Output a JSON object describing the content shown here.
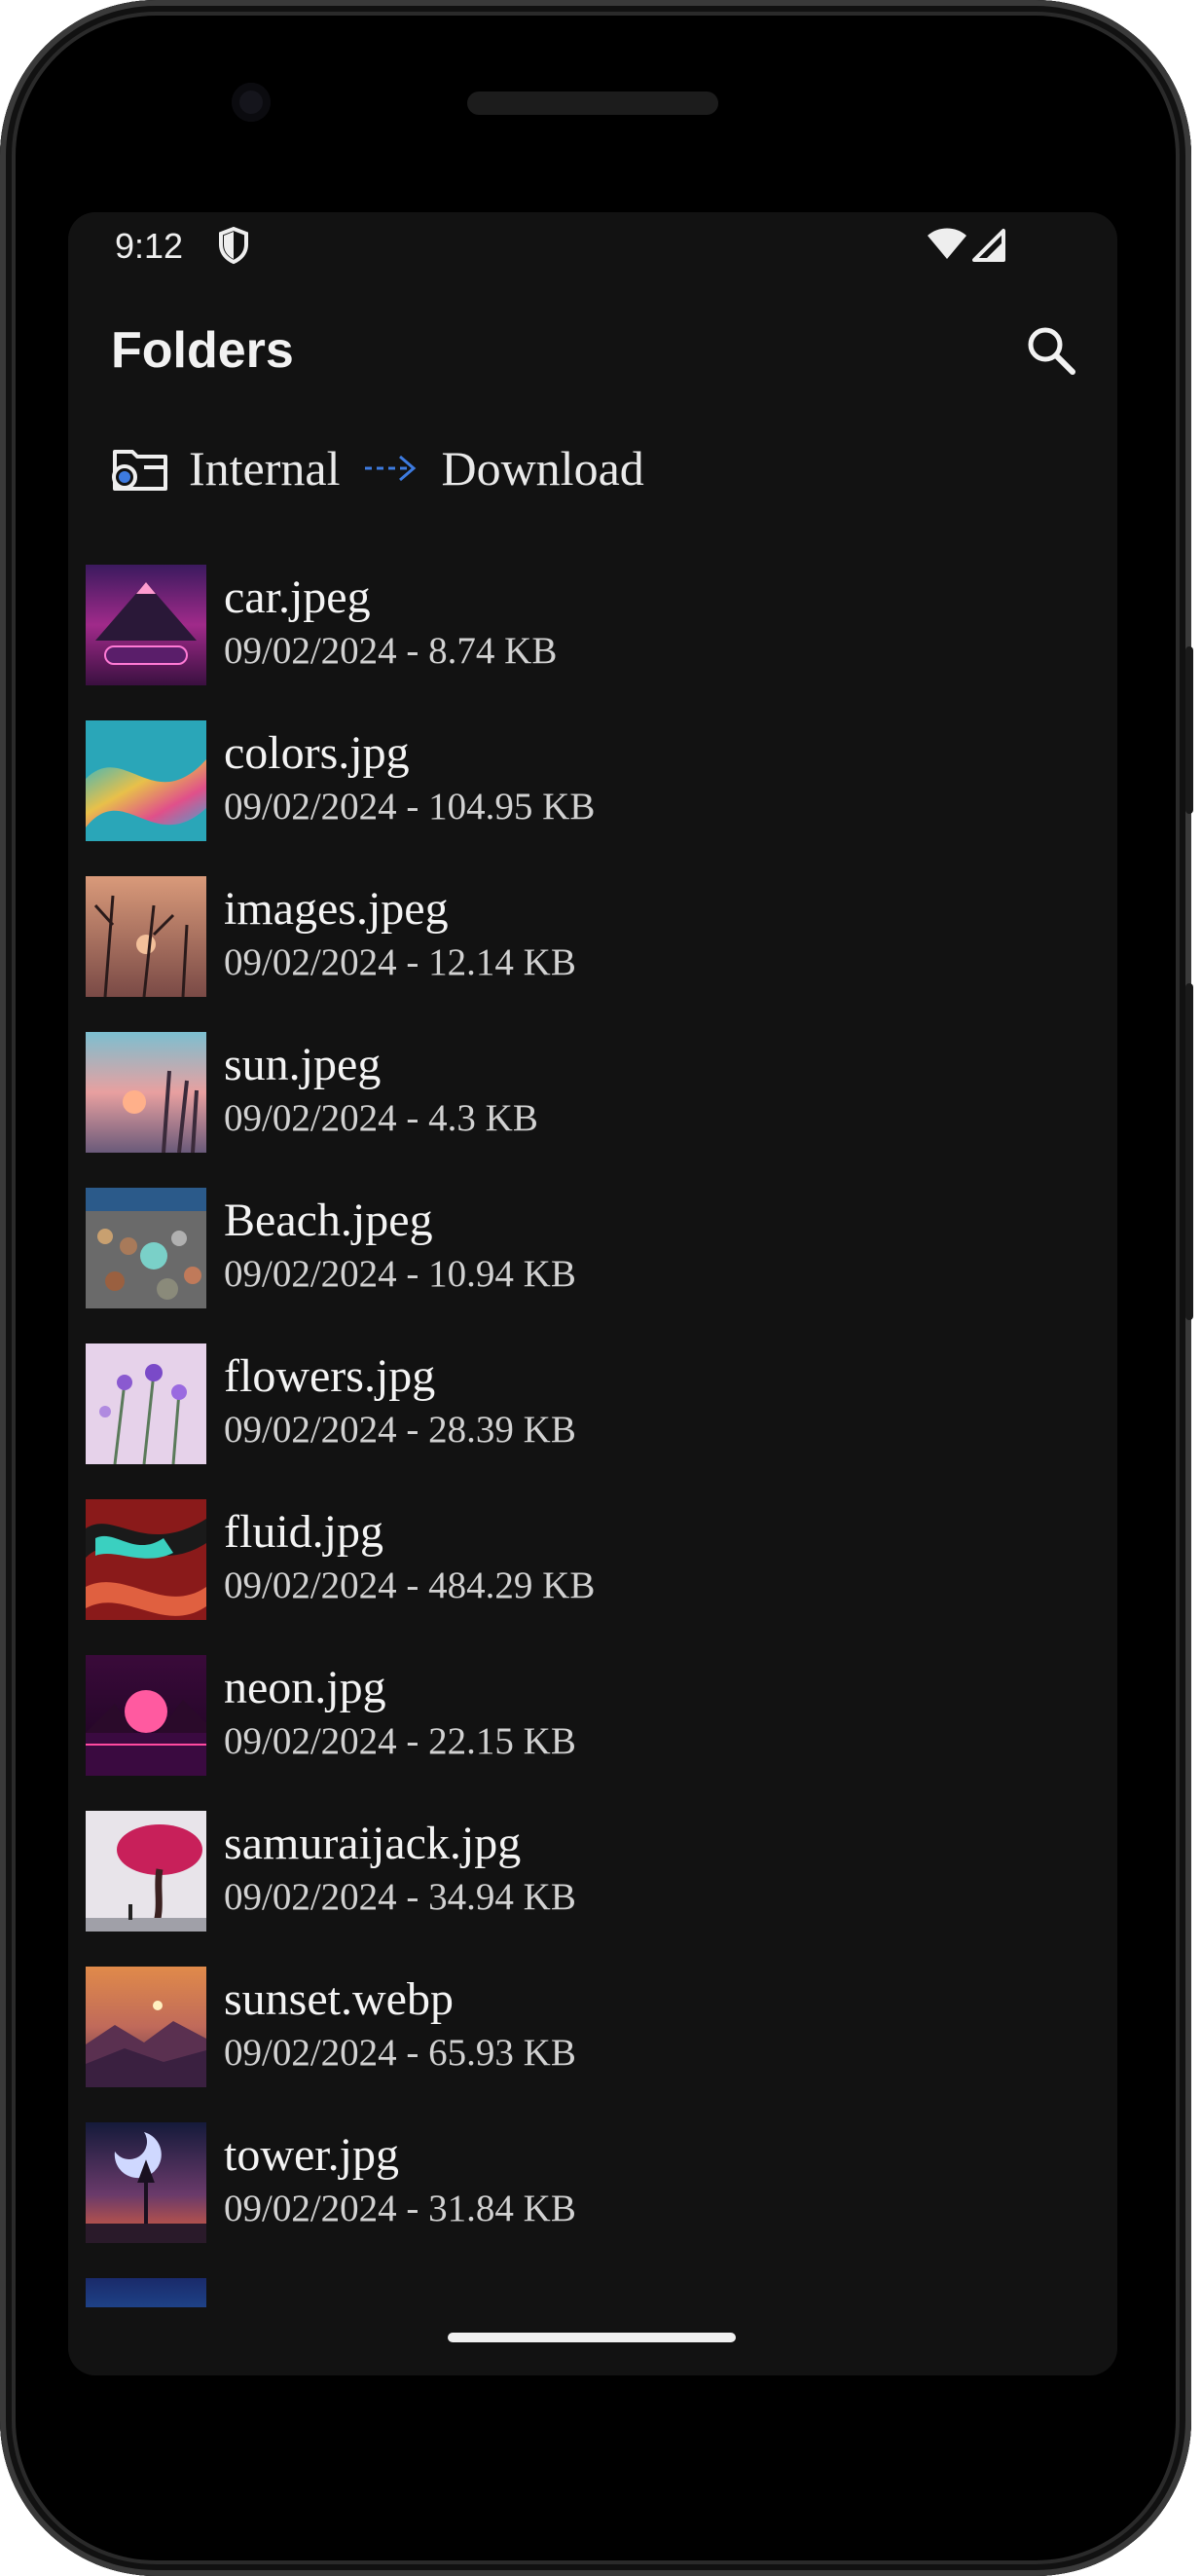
{
  "status_bar": {
    "time": "9:12",
    "shield_icon": "shield-icon",
    "wifi_icon": "wifi-icon",
    "signal_icon": "signal-icon"
  },
  "app_bar": {
    "title": "Folders",
    "search_icon": "search-icon"
  },
  "breadcrumb": {
    "root_icon": "folder-storage-icon",
    "root_label": "Internal",
    "separator_icon": "arrow-right-icon",
    "current_label": "Download"
  },
  "files": [
    {
      "name": "car.jpeg",
      "meta": "09/02/2024 - 8.74 KB"
    },
    {
      "name": "colors.jpg",
      "meta": "09/02/2024 - 104.95 KB"
    },
    {
      "name": "images.jpeg",
      "meta": "09/02/2024 - 12.14 KB"
    },
    {
      "name": "sun.jpeg",
      "meta": "09/02/2024 - 4.3 KB"
    },
    {
      "name": "Beach.jpeg",
      "meta": "09/02/2024 - 10.94 KB"
    },
    {
      "name": "flowers.jpg",
      "meta": "09/02/2024 - 28.39 KB"
    },
    {
      "name": "fluid.jpg",
      "meta": "09/02/2024 - 484.29 KB"
    },
    {
      "name": "neon.jpg",
      "meta": "09/02/2024 - 22.15 KB"
    },
    {
      "name": "samuraijack.jpg",
      "meta": "09/02/2024 - 34.94 KB"
    },
    {
      "name": "sunset.webp",
      "meta": "09/02/2024 - 65.93 KB"
    },
    {
      "name": "tower.jpg",
      "meta": "09/02/2024 - 31.84 KB"
    }
  ],
  "colors": {
    "background": "#121212",
    "accent": "#3d7be0",
    "text_primary": "#f4f4f4",
    "text_secondary": "#d2d2d2"
  }
}
